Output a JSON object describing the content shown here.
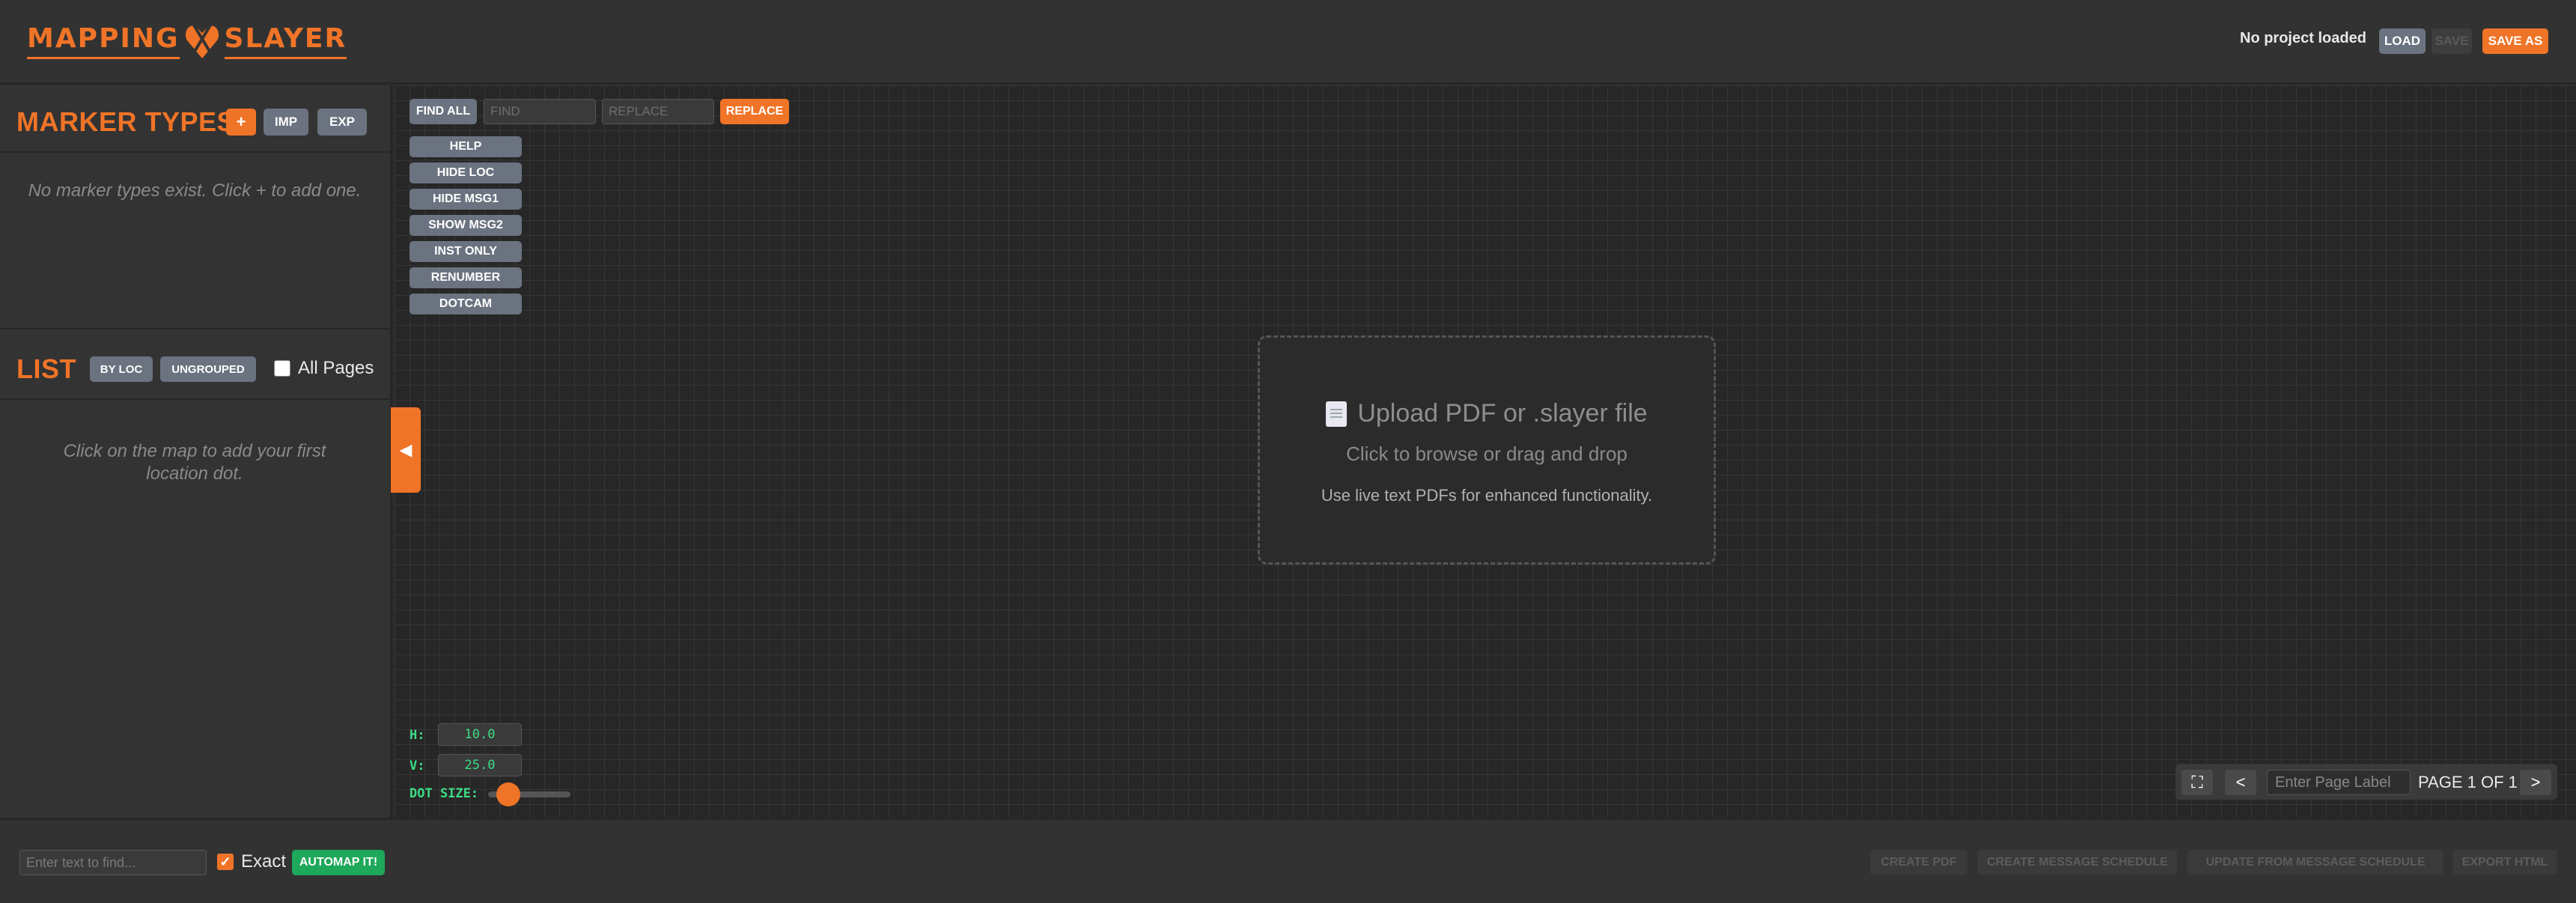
{
  "header": {
    "logo_left": "MAPPING",
    "logo_right": "SLAYER",
    "project_status": "No project loaded",
    "load_label": "LOAD",
    "save_label": "SAVE",
    "save_as_label": "SAVE AS"
  },
  "sidebar": {
    "marker_types_title": "MARKER TYPES",
    "add_label": "+",
    "imp_label": "IMP",
    "exp_label": "EXP",
    "marker_types_empty": "No marker types exist. Click + to add one.",
    "list_title": "LIST",
    "by_loc_label": "BY LOC",
    "ungrouped_label": "UNGROUPED",
    "all_pages_label": "All Pages",
    "list_empty": "Click on the map to add your first location dot."
  },
  "collapse_glyph": "◀",
  "map": {
    "find_all_label": "FIND ALL",
    "find_placeholder": "FIND",
    "replace_placeholder": "REPLACE",
    "replace_label": "REPLACE",
    "tools": [
      "HELP",
      "HIDE LOC",
      "HIDE MSG1",
      "SHOW MSG2",
      "INST ONLY",
      "RENUMBER",
      "DOTCAM"
    ],
    "upload_title": "Upload PDF or .slayer file",
    "upload_sub": "Click to browse or drag and drop",
    "upload_hint": "Use live text PDFs for enhanced functionality.",
    "h_label": "H:",
    "h_value": "10.0",
    "v_label": "V:",
    "v_value": "25.0",
    "dot_size_label": "DOT SIZE:",
    "dot_size_value": 0.15,
    "fullscreen_icon": "⛶",
    "prev_label": "<",
    "next_label": ">",
    "page_label_placeholder": "Enter Page Label",
    "page_text": "PAGE 1 OF 1"
  },
  "footer": {
    "find_placeholder": "Enter text to find...",
    "exact_label": "Exact",
    "exact_checked": true,
    "automap_label": "AUTOMAP IT!",
    "create_pdf_label": "CREATE PDF",
    "create_schedule_label": "CREATE MESSAGE SCHEDULE",
    "update_schedule_label": "UPDATE FROM MESSAGE SCHEDULE",
    "export_html_label": "EXPORT HTML"
  },
  "colors": {
    "accent": "#f07427",
    "green": "#1ea85a",
    "button_gray": "#6b7380"
  }
}
